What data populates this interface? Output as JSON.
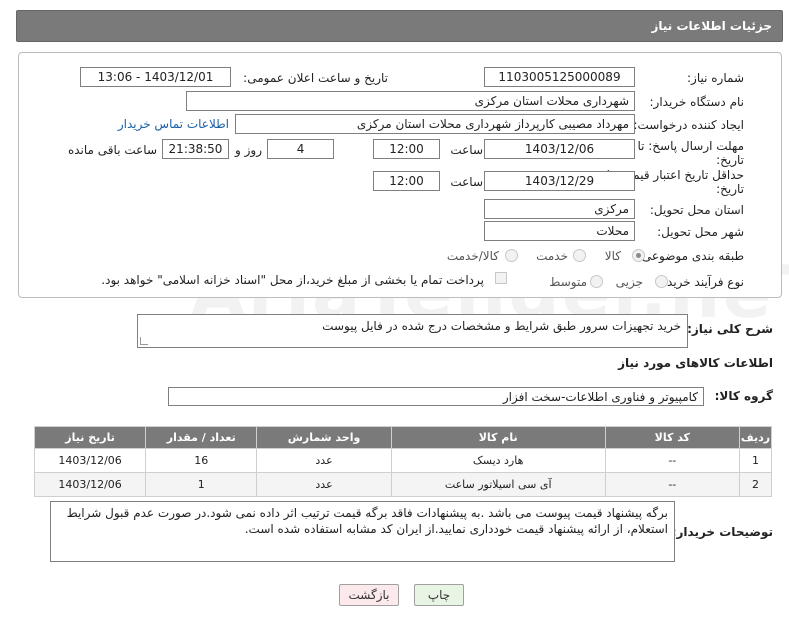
{
  "header": {
    "title": "جزئیات اطلاعات نیاز"
  },
  "form": {
    "need_number_label": "شماره نیاز:",
    "need_number_value": "1103005125000089",
    "announce_datetime_label": "تاریخ و ساعت اعلان عمومی:",
    "announce_datetime_value": "1403/12/01 - 13:06",
    "buyer_org_label": "نام دستگاه خریدار:",
    "buyer_org_value": "شهرداری محلات استان مرکزی",
    "creator_label": "ایجاد کننده درخواست:",
    "creator_value": "مهرداد مصیبی کارپرداز  شهرداری محلات استان مرکزی",
    "buyer_contact_link": "اطلاعات تماس خریدار",
    "reply_deadline_label_1": "مهلت ارسال پاسخ: تا",
    "reply_deadline_label_2": "تاریخ:",
    "reply_date": "1403/12/06",
    "time_label": "ساعت",
    "reply_time": "12:00",
    "days_value": "4",
    "days_label": "روز و",
    "remaining_time": "21:38:50",
    "remaining_label": "ساعت باقی مانده",
    "price_validity_label_1": "حداقل تاریخ اعتبار قیمت: تا",
    "price_validity_label_2": "تاریخ:",
    "price_validity_date": "1403/12/29",
    "price_validity_time_label": "ساعت",
    "price_validity_time": "12:00",
    "province_label": "استان محل تحویل:",
    "province_value": "مرکزی",
    "city_label": "شهر محل تحویل:",
    "city_value": "محلات",
    "category_label": "طبقه بندی موضوعی:",
    "category_options": [
      "کالا",
      "خدمت",
      "کالا/خدمت"
    ],
    "process_label": "نوع فرآیند خرید :",
    "process_options": [
      "جزیی",
      "متوسط"
    ],
    "payment_note": "پرداخت تمام یا بخشی از مبلغ خرید،از محل \"اسناد خزانه اسلامی\" خواهد بود."
  },
  "description": {
    "label": "شرح کلی نیاز:",
    "value": "خرید تجهیزات سرور طبق شرایط و مشخصات درج شده در فایل پیوست"
  },
  "goods_section": {
    "title": "اطلاعات کالاهای مورد نیاز",
    "group_label": "گروه کالا:",
    "group_value": "کامپیوتر و فناوری اطلاعات-سخت افزار"
  },
  "table": {
    "headers": [
      "ردیف",
      "کد کالا",
      "نام کالا",
      "واحد شمارش",
      "تعداد / مقدار",
      "تاریخ نیاز"
    ],
    "rows": [
      [
        "1",
        "--",
        "هارد دیسک",
        "عدد",
        "16",
        "1403/12/06"
      ],
      [
        "2",
        "--",
        "آی سی اسیلاتور ساعت",
        "عدد",
        "1",
        "1403/12/06"
      ]
    ]
  },
  "buyer_notes": {
    "label": "توضیحات خریدار:",
    "value": "برگه پیشنهاد قیمت پیوست می باشد .به پیشنهادات فاقد برگه قیمت ترتیب اثر داده نمی شود.در صورت عدم قبول شرایط استعلام، از ارائه پیشنهاد قیمت خودداری نمایید.از ایران کد مشابه استفاده شده است."
  },
  "buttons": {
    "print": "چاپ",
    "back": "بازگشت"
  },
  "watermark": "AriaTender.neT"
}
